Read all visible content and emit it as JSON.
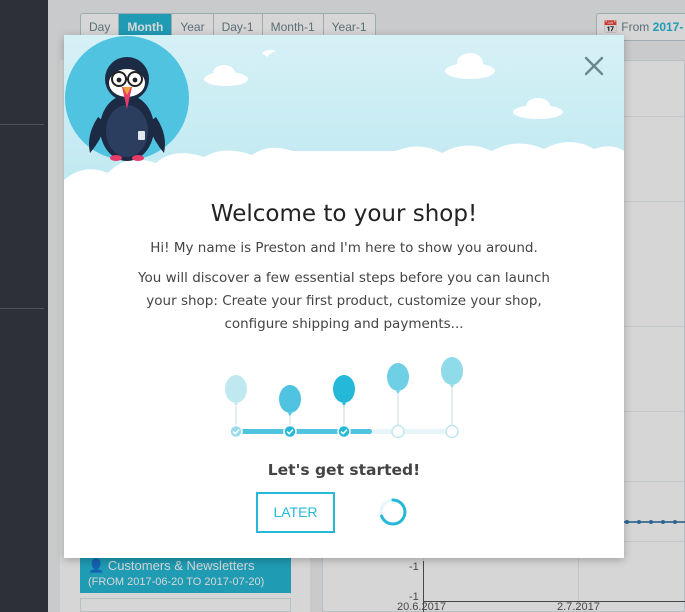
{
  "period_buttons": [
    "Day",
    "Month",
    "Year",
    "Day-1",
    "Month-1",
    "Year-1"
  ],
  "active_period": "Month",
  "date_range": {
    "prefix": "From",
    "value": "2017-"
  },
  "customers_box": {
    "title": "Customers & Newsletters",
    "range": "(FROM 2017-06-20 TO 2017-07-20)"
  },
  "chart_data": {
    "type": "line",
    "x_ticks": [
      "20.6.2017",
      "2.7.2017"
    ],
    "y_ticks": [
      "-1",
      "-1"
    ]
  },
  "modal": {
    "title": "Welcome to your shop!",
    "intro": "Hi! My name is Preston and I'm here to show you around.",
    "description": "You will discover a few essential steps before you can launch your shop: Create your first product, customize your shop, configure shipping and payments...",
    "cta_heading": "Let's get started!",
    "later_label": "LATER",
    "steps_total": 5,
    "steps_completed": 3
  },
  "colors": {
    "accent": "#25b9d7",
    "sidebar": "#363a41"
  },
  "icons": {
    "close": "close-icon",
    "loading": "spinner-icon",
    "user": "user-icon",
    "calendar": "calendar-icon"
  }
}
